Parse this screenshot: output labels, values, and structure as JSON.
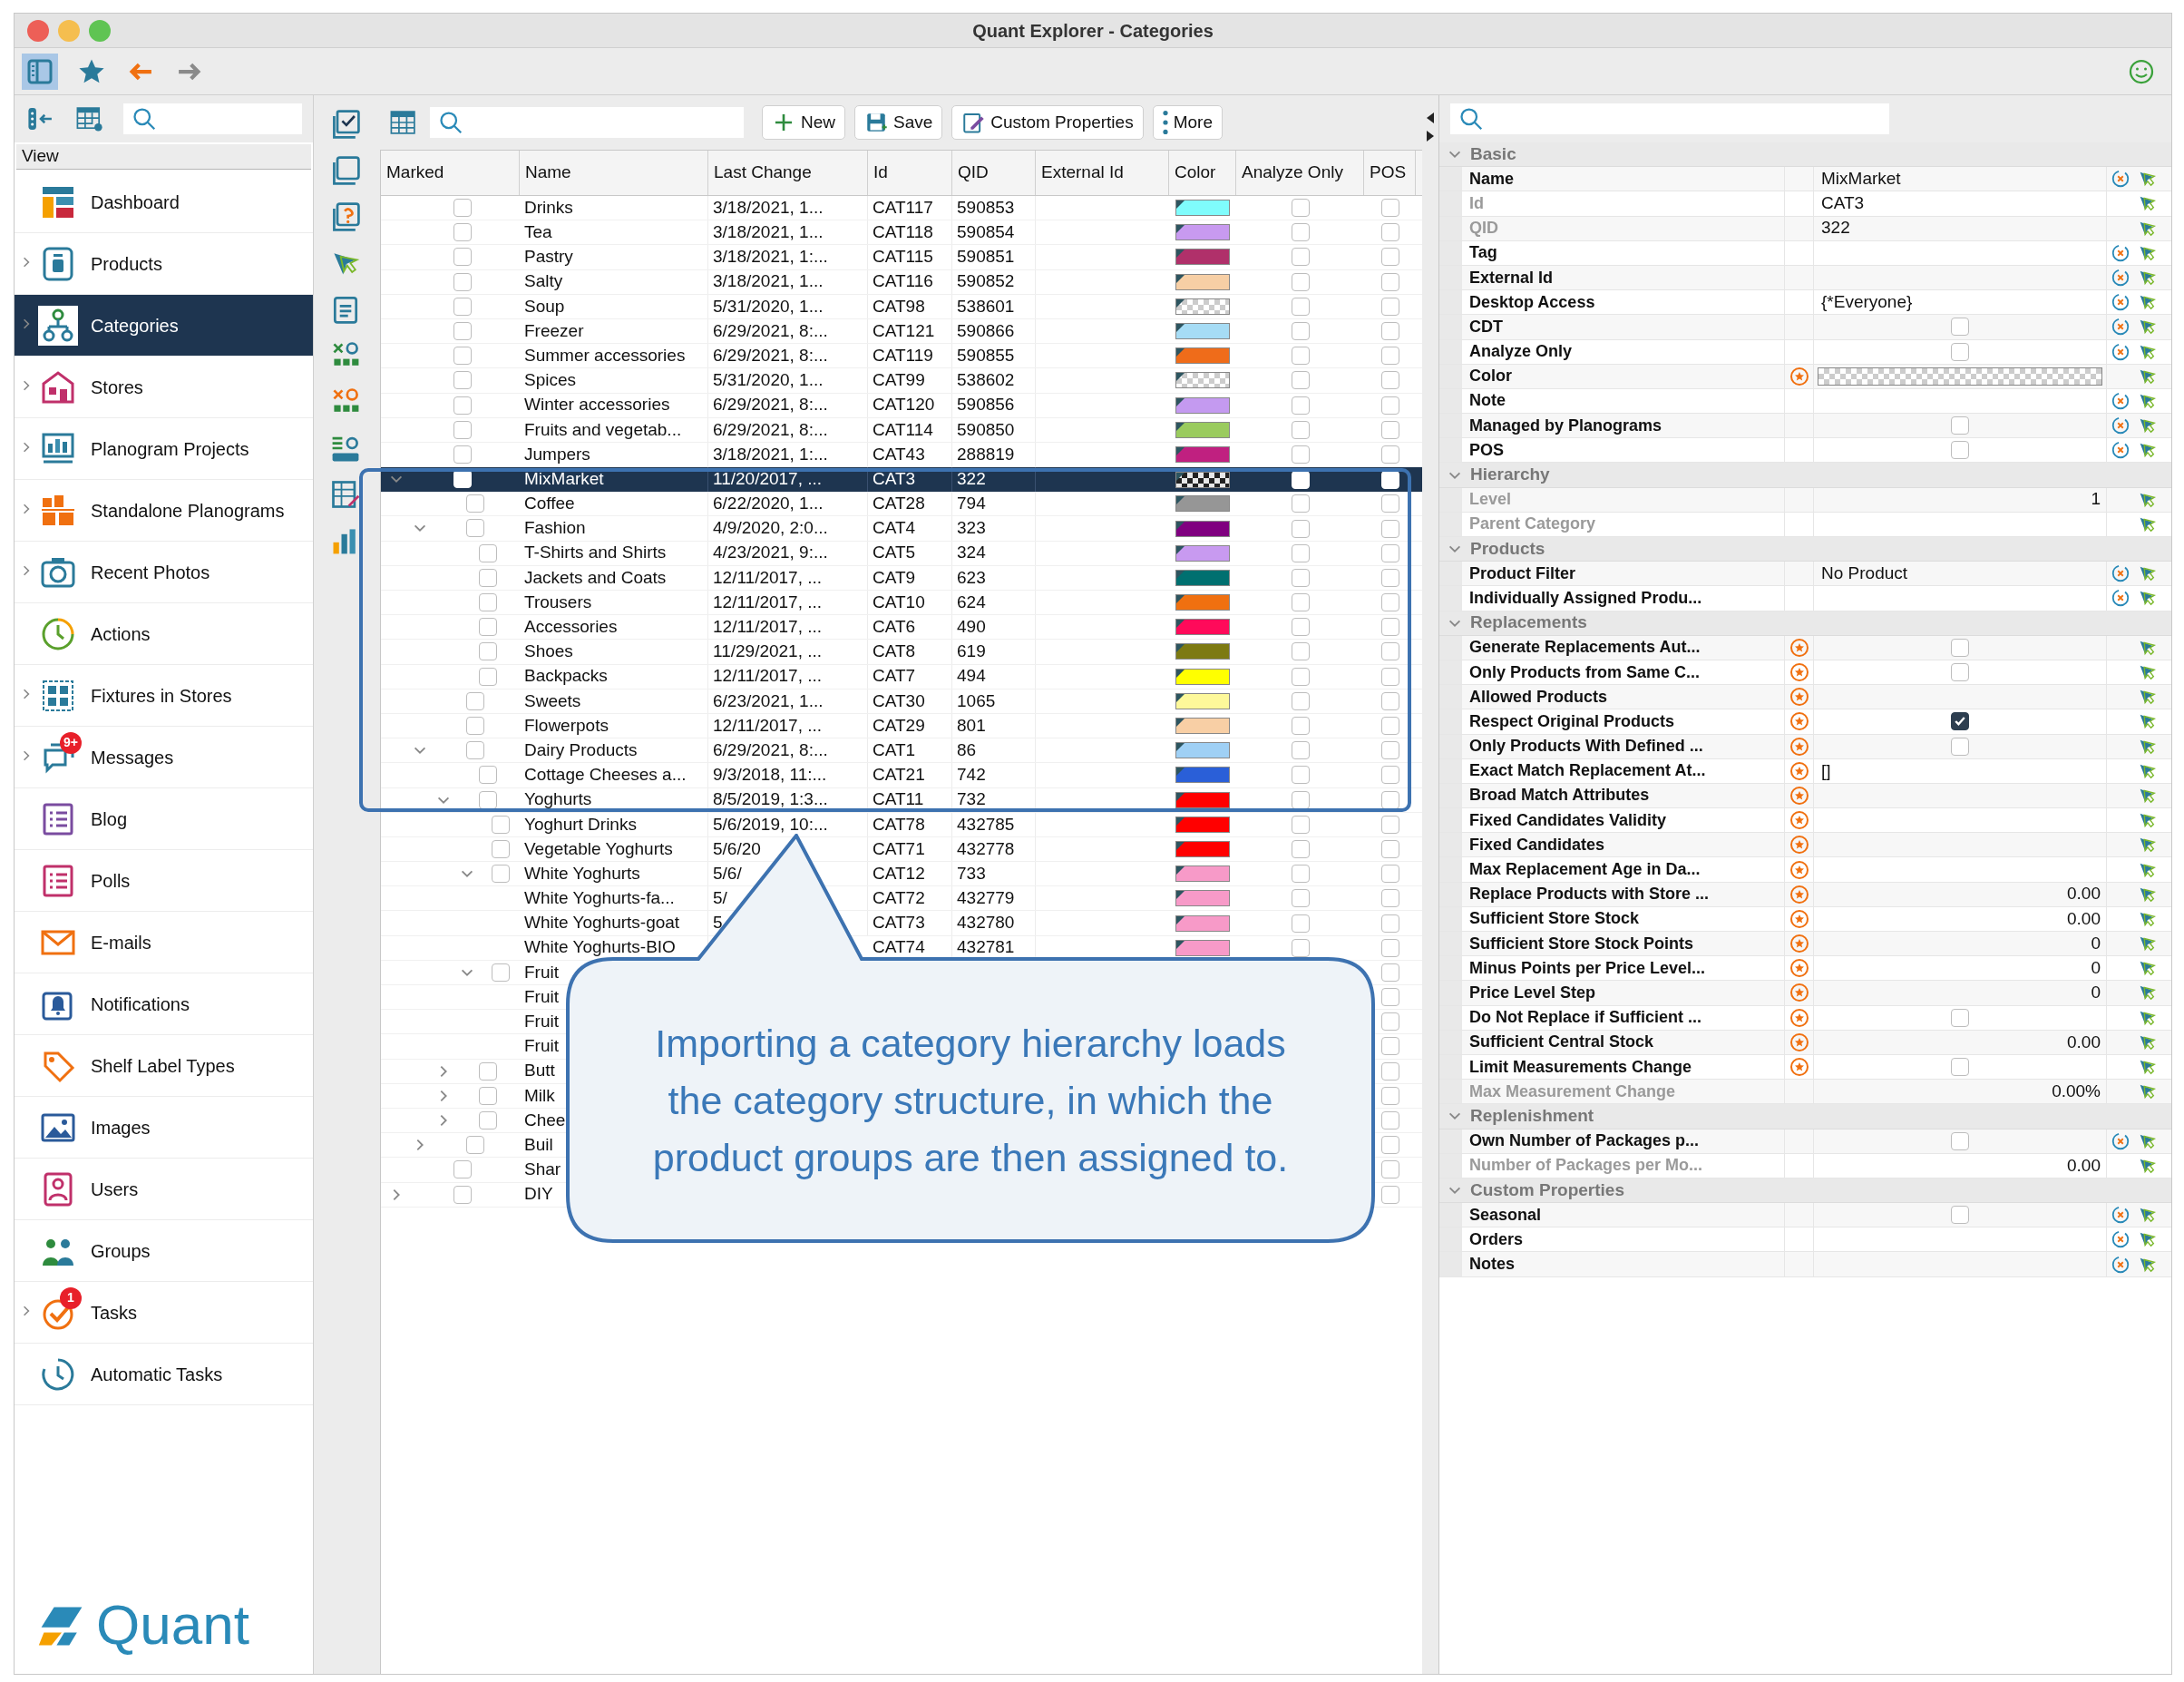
{
  "window": {
    "title": "Quant Explorer - Categories"
  },
  "sidebar": {
    "header": "View",
    "items": [
      {
        "label": "Dashboard",
        "expandable": false,
        "selected": false
      },
      {
        "label": "Products",
        "expandable": true,
        "selected": false
      },
      {
        "label": "Categories",
        "expandable": true,
        "selected": true
      },
      {
        "label": "Stores",
        "expandable": true,
        "selected": false
      },
      {
        "label": "Planogram Projects",
        "expandable": true,
        "selected": false
      },
      {
        "label": "Standalone Planograms",
        "expandable": true,
        "selected": false
      },
      {
        "label": "Recent Photos",
        "expandable": true,
        "selected": false
      },
      {
        "label": "Actions",
        "expandable": false,
        "selected": false
      },
      {
        "label": "Fixtures in Stores",
        "expandable": true,
        "selected": false
      },
      {
        "label": "Messages",
        "expandable": true,
        "selected": false,
        "badge": "9+"
      },
      {
        "label": "Blog",
        "expandable": false,
        "selected": false
      },
      {
        "label": "Polls",
        "expandable": false,
        "selected": false
      },
      {
        "label": "E-mails",
        "expandable": false,
        "selected": false
      },
      {
        "label": "Notifications",
        "expandable": false,
        "selected": false
      },
      {
        "label": "Shelf Label Types",
        "expandable": false,
        "selected": false
      },
      {
        "label": "Images",
        "expandable": false,
        "selected": false
      },
      {
        "label": "Users",
        "expandable": false,
        "selected": false
      },
      {
        "label": "Groups",
        "expandable": false,
        "selected": false
      },
      {
        "label": "Tasks",
        "expandable": true,
        "selected": false,
        "badge": "1"
      },
      {
        "label": "Automatic Tasks",
        "expandable": false,
        "selected": false
      }
    ]
  },
  "logo": {
    "text": "Quant"
  },
  "table": {
    "buttons": [
      "New",
      "Save",
      "Custom Properties",
      "More"
    ],
    "columns": [
      "Marked",
      "Name",
      "Last Change",
      "Id",
      "QID",
      "External Id",
      "Color",
      "Analyze Only",
      "POS"
    ],
    "rows": [
      {
        "name": "Drinks",
        "last_change": "3/18/2021, 1...",
        "id": "CAT117",
        "qid": "590853",
        "color": "#7ffcfc",
        "marked": false,
        "analyze_only": false,
        "pos": false,
        "selected": false
      },
      {
        "name": "Tea",
        "last_change": "3/18/2021, 1...",
        "id": "CAT118",
        "qid": "590854",
        "color": "#c89af0",
        "marked": false,
        "analyze_only": false,
        "pos": false,
        "selected": false
      },
      {
        "name": "Pastry",
        "last_change": "3/18/2021, 1:...",
        "id": "CAT115",
        "qid": "590851",
        "color": "#b0306a",
        "marked": false,
        "analyze_only": false,
        "pos": false,
        "selected": false
      },
      {
        "name": "Salty",
        "last_change": "3/18/2021, 1...",
        "id": "CAT116",
        "qid": "590852",
        "color": "#f7cfa5",
        "marked": false,
        "analyze_only": false,
        "pos": false,
        "selected": false
      },
      {
        "name": "Soup",
        "last_change": "5/31/2020, 1...",
        "id": "CAT98",
        "qid": "538601",
        "transparent": true,
        "marked": false,
        "analyze_only": false,
        "pos": false,
        "selected": false
      },
      {
        "name": "Freezer",
        "last_change": "6/29/2021, 8:...",
        "id": "CAT121",
        "qid": "590866",
        "color": "#a6dcf5",
        "marked": false,
        "analyze_only": false,
        "pos": false,
        "selected": false
      },
      {
        "name": "Summer accessories",
        "last_change": "6/29/2021, 8:...",
        "id": "CAT119",
        "qid": "590855",
        "color": "#ef6c1a",
        "marked": false,
        "analyze_only": false,
        "pos": false,
        "selected": false
      },
      {
        "name": "Spices",
        "last_change": "5/31/2020, 1...",
        "id": "CAT99",
        "qid": "538602",
        "transparent": true,
        "marked": false,
        "analyze_only": false,
        "pos": false,
        "selected": false
      },
      {
        "name": "Winter accessories",
        "last_change": "6/29/2021, 8:...",
        "id": "CAT120",
        "qid": "590856",
        "color": "#c49af0",
        "marked": false,
        "analyze_only": false,
        "pos": false,
        "selected": false
      },
      {
        "name": "Fruits and vegetab...",
        "last_change": "6/29/2021, 8:...",
        "id": "CAT114",
        "qid": "590850",
        "color": "#9acb5e",
        "marked": false,
        "analyze_only": false,
        "pos": false,
        "selected": false
      },
      {
        "name": "Jumpers",
        "last_change": "3/18/2021, 1:...",
        "id": "CAT43",
        "qid": "288819",
        "color": "#c02080",
        "marked": false,
        "analyze_only": false,
        "pos": false,
        "selected": false
      },
      {
        "name": "MixMarket",
        "last_change": "11/20/2017, ...",
        "id": "CAT3",
        "qid": "322",
        "transparent": true,
        "marked": false,
        "analyze_only": false,
        "pos": false,
        "selected": true,
        "expanded": true,
        "children": [
          {
            "name": "Coffee",
            "last_change": "6/22/2020, 1...",
            "id": "CAT28",
            "qid": "794",
            "color": "#969696",
            "marked": false,
            "analyze_only": false,
            "pos": false,
            "selected": false
          },
          {
            "name": "Fashion",
            "last_change": "4/9/2020, 2:0...",
            "id": "CAT4",
            "qid": "323",
            "color": "#800080",
            "marked": false,
            "analyze_only": false,
            "pos": false,
            "selected": false,
            "expanded": true,
            "children": [
              {
                "name": "T-Shirts and Shirts",
                "last_change": "4/23/2021, 9:...",
                "id": "CAT5",
                "qid": "324",
                "color": "#c89af0",
                "marked": false,
                "analyze_only": false,
                "pos": false,
                "selected": false
              },
              {
                "name": "Jackets and Coats",
                "last_change": "12/11/2017, ...",
                "id": "CAT9",
                "qid": "623",
                "color": "#007070",
                "marked": false,
                "analyze_only": false,
                "pos": false,
                "selected": false
              },
              {
                "name": "Trousers",
                "last_change": "12/11/2017, ...",
                "id": "CAT10",
                "qid": "624",
                "color": "#f07010",
                "marked": false,
                "analyze_only": false,
                "pos": false,
                "selected": false
              },
              {
                "name": "Accessories",
                "last_change": "12/11/2017, ...",
                "id": "CAT6",
                "qid": "490",
                "color": "#ff0a5a",
                "marked": false,
                "analyze_only": false,
                "pos": false,
                "selected": false
              },
              {
                "name": "Shoes",
                "last_change": "11/29/2021, ...",
                "id": "CAT8",
                "qid": "619",
                "color": "#7d7a12",
                "marked": false,
                "analyze_only": false,
                "pos": false,
                "selected": false
              },
              {
                "name": "Backpacks",
                "last_change": "12/11/2017, ...",
                "id": "CAT7",
                "qid": "494",
                "color": "#ffff00",
                "marked": false,
                "analyze_only": false,
                "pos": false,
                "selected": false
              }
            ]
          },
          {
            "name": "Sweets",
            "last_change": "6/23/2021, 1...",
            "id": "CAT30",
            "qid": "1065",
            "color": "#fdf89a",
            "marked": false,
            "analyze_only": false,
            "pos": false,
            "selected": false
          },
          {
            "name": "Flowerpots",
            "last_change": "12/11/2017, ...",
            "id": "CAT29",
            "qid": "801",
            "color": "#f8cfa5",
            "marked": false,
            "analyze_only": false,
            "pos": false,
            "selected": false
          },
          {
            "name": "Dairy Products",
            "last_change": "6/29/2021, 8:...",
            "id": "CAT1",
            "qid": "86",
            "color": "#9fd0f5",
            "marked": false,
            "analyze_only": false,
            "pos": false,
            "selected": false,
            "expanded": true,
            "children": [
              {
                "name": "Cottage Cheeses a...",
                "last_change": "9/3/2018, 11:...",
                "id": "CAT21",
                "qid": "742",
                "color": "#2a5fd8",
                "marked": false,
                "analyze_only": false,
                "pos": false,
                "selected": false
              },
              {
                "name": "Yoghurts",
                "last_change": "8/5/2019, 1:3...",
                "id": "CAT11",
                "qid": "732",
                "color": "#ff0000",
                "marked": false,
                "analyze_only": false,
                "pos": false,
                "selected": false,
                "expanded": true,
                "children": [
                  {
                    "name": "Yoghurt Drinks",
                    "last_change": "5/6/2019, 10:...",
                    "id": "CAT78",
                    "qid": "432785",
                    "color": "#ff0000",
                    "marked": false,
                    "analyze_only": false,
                    "pos": false,
                    "selected": false
                  },
                  {
                    "name": "Vegetable Yoghurts",
                    "last_change": "5/6/20",
                    "id": "CAT71",
                    "qid": "432778",
                    "color": "#ff0000",
                    "marked": false,
                    "analyze_only": false,
                    "pos": false,
                    "selected": false
                  },
                  {
                    "name": "White Yoghurts",
                    "last_change": "5/6/",
                    "id": "CAT12",
                    "qid": "733",
                    "color": "#f79ac8",
                    "marked": false,
                    "analyze_only": false,
                    "pos": false,
                    "selected": false,
                    "expanded": true,
                    "children": [
                      {
                        "name": "White Yoghurts-fa...",
                        "last_change": "5/",
                        "id": "CAT72",
                        "qid": "432779",
                        "color": "#f79ac8",
                        "analyze_only": false,
                        "pos": false,
                        "selected": false
                      },
                      {
                        "name": "White Yoghurts-goat",
                        "last_change": "5",
                        "id": "CAT73",
                        "qid": "432780",
                        "color": "#f79ac8",
                        "analyze_only": false,
                        "pos": false,
                        "selected": false
                      },
                      {
                        "name": "White Yoghurts-BIO",
                        "id": "CAT74",
                        "qid": "432781",
                        "color": "#f79ac8",
                        "analyze_only": false,
                        "pos": false,
                        "selected": false
                      }
                    ]
                  },
                  {
                    "name": "Fruit",
                    "marked": false,
                    "pos": false,
                    "selected": false,
                    "expanded": true,
                    "children": [
                      {
                        "name": "Fruit",
                        "pos": false,
                        "selected": false
                      },
                      {
                        "name": "Fruit",
                        "pos": false,
                        "selected": false
                      },
                      {
                        "name": "Fruit",
                        "pos": false,
                        "selected": false
                      }
                    ]
                  }
                ]
              },
              {
                "name": "Butt",
                "marked": false,
                "pos": false,
                "selected": false,
                "expanded": false
              },
              {
                "name": "Milk",
                "marked": false,
                "pos": false,
                "selected": false,
                "expanded": false
              },
              {
                "name": "Chee",
                "marked": false,
                "pos": false,
                "selected": false,
                "expanded": false
              }
            ]
          },
          {
            "name": "Buil",
            "marked": false,
            "pos": false,
            "selected": false,
            "expanded": false
          }
        ]
      },
      {
        "name": "Shar",
        "marked": false,
        "pos": false,
        "selected": false
      },
      {
        "name": "DIY",
        "marked": false,
        "pos": false,
        "selected": false,
        "expanded": false
      }
    ]
  },
  "callout": {
    "text": "Importing a category hierarchy loads the category structure, in which the product groups are then assigned to."
  },
  "properties": {
    "sections": [
      {
        "title": "Basic",
        "expanded": true,
        "rows": [
          {
            "label": "Name",
            "disabled": false,
            "inherited": false,
            "kind": "text",
            "value": "MixMarket",
            "clearable": true
          },
          {
            "label": "Id",
            "disabled": true,
            "inherited": false,
            "kind": "text",
            "value": "CAT3",
            "clearable": false
          },
          {
            "label": "QID",
            "disabled": true,
            "inherited": false,
            "kind": "text",
            "value": "322",
            "clearable": false
          },
          {
            "label": "Tag",
            "disabled": false,
            "inherited": false,
            "kind": "empty",
            "clearable": true
          },
          {
            "label": "External Id",
            "disabled": false,
            "inherited": false,
            "kind": "empty",
            "clearable": true
          },
          {
            "label": "Desktop Access",
            "disabled": false,
            "inherited": false,
            "kind": "text",
            "value": "{*Everyone}",
            "clearable": true
          },
          {
            "label": "CDT",
            "disabled": false,
            "inherited": false,
            "kind": "checkbox",
            "checked": false,
            "clearable": true
          },
          {
            "label": "Analyze Only",
            "disabled": false,
            "inherited": false,
            "kind": "checkbox",
            "checked": false,
            "clearable": true
          },
          {
            "label": "Color",
            "disabled": false,
            "inherited": true,
            "kind": "checker",
            "clearable": false
          },
          {
            "label": "Note",
            "disabled": false,
            "inherited": false,
            "kind": "empty",
            "clearable": true
          },
          {
            "label": "Managed by Planograms",
            "disabled": false,
            "inherited": false,
            "kind": "checkbox",
            "checked": false,
            "clearable": true
          },
          {
            "label": "POS",
            "disabled": false,
            "inherited": false,
            "kind": "checkbox",
            "checked": false,
            "clearable": true
          }
        ]
      },
      {
        "title": "Hierarchy",
        "expanded": true,
        "rows": [
          {
            "label": "Level",
            "disabled": true,
            "inherited": false,
            "kind": "number",
            "value": "1",
            "clearable": false
          },
          {
            "label": "Parent Category",
            "disabled": true,
            "inherited": false,
            "kind": "empty",
            "clearable": false
          }
        ]
      },
      {
        "title": "Products",
        "expanded": true,
        "rows": [
          {
            "label": "Product Filter",
            "disabled": false,
            "inherited": false,
            "kind": "text",
            "value": "No Product",
            "clearable": true
          },
          {
            "label": "Individually Assigned Produ...",
            "disabled": false,
            "inherited": false,
            "kind": "empty",
            "clearable": true
          }
        ]
      },
      {
        "title": "Replacements",
        "expanded": true,
        "rows": [
          {
            "label": "Generate Replacements Aut...",
            "disabled": false,
            "inherited": true,
            "kind": "checkbox",
            "checked": false,
            "clearable": false
          },
          {
            "label": "Only Products from Same C...",
            "disabled": false,
            "inherited": true,
            "kind": "checkbox",
            "checked": false,
            "clearable": false
          },
          {
            "label": "Allowed Products",
            "disabled": false,
            "inherited": true,
            "kind": "empty",
            "clearable": false
          },
          {
            "label": "Respect Original Products",
            "disabled": false,
            "inherited": true,
            "kind": "checkbox",
            "checked": true,
            "clearable": false
          },
          {
            "label": "Only Products With Defined ...",
            "disabled": false,
            "inherited": true,
            "kind": "checkbox",
            "checked": false,
            "clearable": false
          },
          {
            "label": "Exact Match Replacement At...",
            "disabled": false,
            "inherited": true,
            "kind": "text",
            "value": "[]",
            "clearable": false
          },
          {
            "label": "Broad Match Attributes",
            "disabled": false,
            "inherited": true,
            "kind": "empty",
            "clearable": false
          },
          {
            "label": "Fixed Candidates Validity",
            "disabled": false,
            "inherited": true,
            "kind": "empty",
            "clearable": false
          },
          {
            "label": "Fixed Candidates",
            "disabled": false,
            "inherited": true,
            "kind": "empty",
            "clearable": false
          },
          {
            "label": "Max Replacement Age in Da...",
            "disabled": false,
            "inherited": true,
            "kind": "empty",
            "clearable": false
          },
          {
            "label": "Replace Products with Store ...",
            "disabled": false,
            "inherited": true,
            "kind": "number",
            "value": "0.00",
            "clearable": false
          },
          {
            "label": "Sufficient Store Stock",
            "disabled": false,
            "inherited": true,
            "kind": "number",
            "value": "0.00",
            "clearable": false
          },
          {
            "label": "Sufficient Store Stock Points",
            "disabled": false,
            "inherited": true,
            "kind": "number",
            "value": "0",
            "clearable": false
          },
          {
            "label": "Minus Points per Price Level...",
            "disabled": false,
            "inherited": true,
            "kind": "number",
            "value": "0",
            "clearable": false
          },
          {
            "label": "Price Level Step",
            "disabled": false,
            "inherited": true,
            "kind": "number",
            "value": "0",
            "clearable": false
          },
          {
            "label": "Do Not Replace if Sufficient ...",
            "disabled": false,
            "inherited": true,
            "kind": "checkbox",
            "checked": false,
            "clearable": false
          },
          {
            "label": "Sufficient Central Stock",
            "disabled": false,
            "inherited": true,
            "kind": "number",
            "value": "0.00",
            "clearable": false
          },
          {
            "label": "Limit Measurements Change",
            "disabled": false,
            "inherited": true,
            "kind": "checkbox",
            "checked": false,
            "clearable": false
          },
          {
            "label": "Max Measurement Change",
            "disabled": true,
            "inherited": false,
            "kind": "number",
            "value": "0.00%",
            "clearable": false
          }
        ]
      },
      {
        "title": "Replenishment",
        "expanded": true,
        "rows": [
          {
            "label": "Own Number of Packages p...",
            "disabled": false,
            "inherited": false,
            "kind": "checkbox",
            "checked": false,
            "clearable": true
          },
          {
            "label": "Number of Packages per Mo...",
            "disabled": true,
            "inherited": false,
            "kind": "number",
            "value": "0.00",
            "clearable": false
          }
        ]
      },
      {
        "title": "Custom Properties",
        "expanded": true,
        "rows": [
          {
            "label": "Seasonal",
            "disabled": false,
            "inherited": false,
            "kind": "checkbox",
            "checked": false,
            "clearable": true
          },
          {
            "label": "Orders",
            "disabled": false,
            "inherited": false,
            "kind": "empty",
            "clearable": true
          },
          {
            "label": "Notes",
            "disabled": false,
            "inherited": false,
            "kind": "empty",
            "clearable": true
          }
        ]
      }
    ]
  }
}
